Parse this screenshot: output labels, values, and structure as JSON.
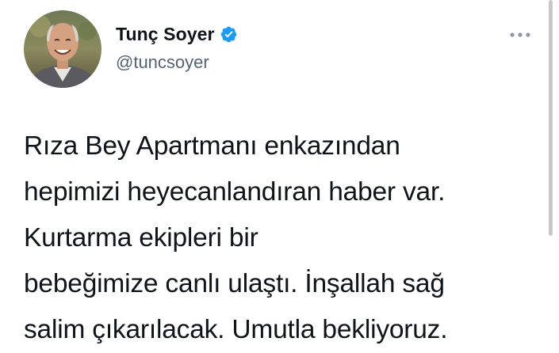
{
  "tweet": {
    "author": {
      "name": "Tunç Soyer",
      "handle": "@tuncsoyer",
      "verified": true,
      "avatar_icon": "profile-photo"
    },
    "more_icon": "more-horizontal-icon",
    "text_lines": [
      "Rıza Bey Apartmanı enkazından",
      "hepimizi heyecanlandıran haber var.",
      "Kurtarma ekipleri bir",
      "bebeğimize canlı ulaştı. İnşallah sağ",
      "salim çıkarılacak. Umutla bekliyoruz."
    ]
  },
  "colors": {
    "verified_badge": "#1d9bf0",
    "handle": "#536471",
    "text": "#0f1419",
    "icon_gray": "#8b98a5",
    "scrollbar": "#c8c8c8"
  }
}
